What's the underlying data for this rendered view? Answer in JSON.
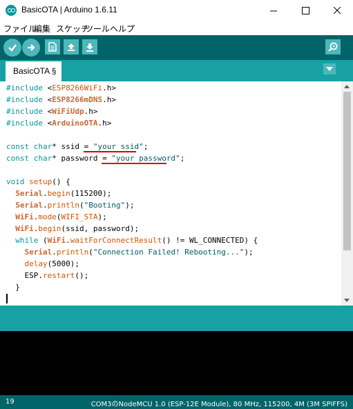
{
  "window": {
    "title": "BasicOTA | Arduino 1.6.11",
    "controls": [
      "minimize-icon",
      "maximize-icon",
      "close-icon"
    ]
  },
  "menu": {
    "items": [
      "ファイル",
      "編集",
      "スケッチ",
      "ツール",
      "ヘルプ"
    ]
  },
  "toolbar": {
    "buttons": [
      "verify-icon",
      "upload-icon",
      "new-icon",
      "open-icon",
      "save-icon"
    ],
    "serial_monitor": "serial-monitor-icon"
  },
  "tabs": [
    {
      "label": "BasicOTA §"
    }
  ],
  "editor": {
    "cursor_line": 19,
    "highlighted_values": [
      "\"your ssid\"",
      "\"your password\""
    ]
  },
  "footer": {
    "line": "19",
    "board": "COM3のNodeMCU 1.0 (ESP-12E Module), 80 MHz, 115200, 4M (3M SPIFFS)"
  },
  "colors": {
    "toolbar": "#006468",
    "tabbar": "#17a1a5",
    "button": "#4db7bb",
    "keyword": "#00979c",
    "function": "#d35400",
    "class": "#cc6633",
    "underline": "#e00000"
  }
}
